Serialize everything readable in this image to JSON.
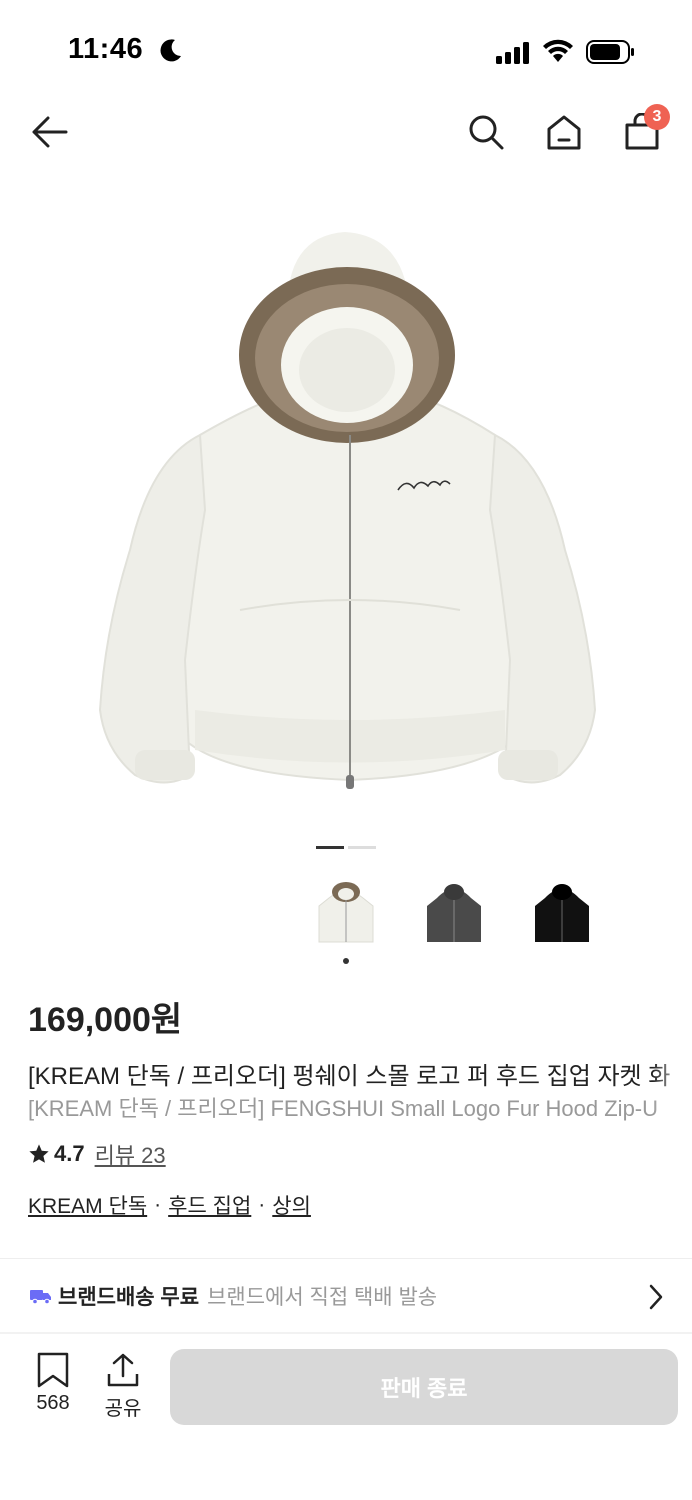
{
  "status_bar": {
    "time": "11:46",
    "moon_icon": "moon-icon",
    "signal_icon": "cellular-signal-icon",
    "wifi_icon": "wifi-icon",
    "battery_icon": "battery-icon"
  },
  "nav": {
    "back_icon": "arrow-left-icon",
    "search_icon": "search-icon",
    "home_icon": "home-icon",
    "bag_icon": "shopping-bag-icon",
    "cart_count": "3",
    "badge_color": "#ef6253"
  },
  "product": {
    "image_pages": 2,
    "active_page": 1,
    "thumbnails": [
      {
        "name": "ivory-fur-hood-thumb",
        "color": "#f0f0ea"
      },
      {
        "name": "charcoal-hood-thumb",
        "color": "#4a4a4a"
      },
      {
        "name": "black-hood-thumb",
        "color": "#111111"
      }
    ],
    "price": "169,000원",
    "title_ko": "[KREAM 단독 / 프리오더] 펑쉐이 스몰 로고 퍼 후드 집업 자켓 화",
    "title_en": "[KREAM 단독 / 프리오더] FENGSHUI Small Logo Fur Hood Zip-U",
    "rating": "4.7",
    "review_label": "리뷰 23",
    "categories": [
      "KREAM 단독",
      "후드 집업",
      "상의"
    ],
    "category_separator": "·"
  },
  "shipping": {
    "icon": "truck-icon",
    "main": "브랜드배송 무료",
    "sub": "브랜드에서 직접 택배 발송",
    "accent_color": "#6b6cf6"
  },
  "bottom_bar": {
    "bookmark_count": "568",
    "share_label": "공유",
    "sold_out_label": "판매 종료"
  }
}
